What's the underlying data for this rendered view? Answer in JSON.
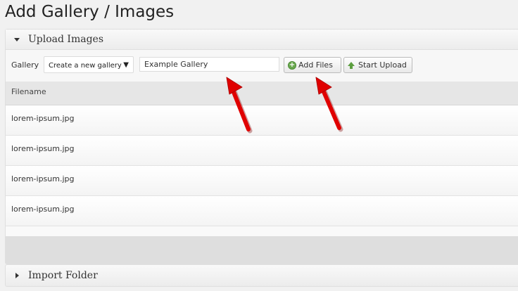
{
  "page": {
    "title": "Add Gallery / Images"
  },
  "upload_panel": {
    "title": "Upload Images",
    "gallery_label": "Gallery",
    "gallery_select": {
      "value": "Create a new gallery"
    },
    "gallery_name_input": {
      "value": "Example Gallery"
    },
    "add_files_label": "Add Files",
    "start_upload_label": "Start Upload",
    "table": {
      "header": "Filename",
      "rows": [
        "lorem-ipsum.jpg",
        "lorem-ipsum.jpg",
        "lorem-ipsum.jpg",
        "lorem-ipsum.jpg"
      ]
    }
  },
  "import_panel": {
    "title": "Import Folder"
  },
  "colors": {
    "annotation_arrow": "#e00000",
    "add_icon": "#6aa84f",
    "upload_icon": "#5c9e3f"
  },
  "icons": [
    "collapse-triangle-icon",
    "plus-circle-icon",
    "upload-arrow-icon",
    "expand-triangle-icon",
    "annotation-arrow-icon"
  ]
}
